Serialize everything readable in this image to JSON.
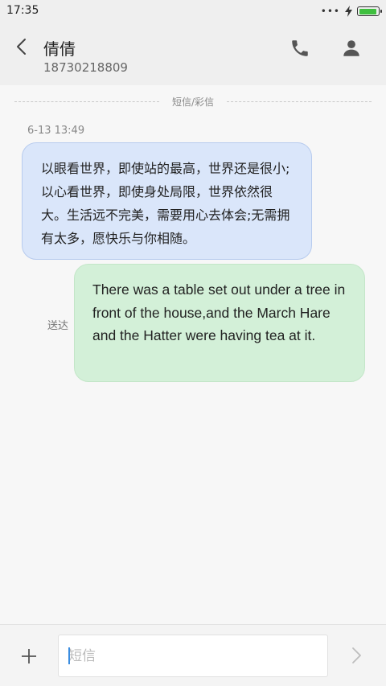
{
  "status_bar": {
    "time": "17:35",
    "signal_dots": "•••",
    "battery_fraction": 0.95,
    "icons": [
      "more-dots-icon",
      "charging-bolt-icon",
      "battery-icon"
    ]
  },
  "header": {
    "contact_name": "倩倩",
    "phone_number": "18730218809",
    "icons": [
      "back-arrow-icon",
      "phone-call-icon",
      "contact-profile-icon"
    ]
  },
  "conversation": {
    "channel_label": "短信/彩信",
    "timestamp": "6-13 13:49",
    "messages": [
      {
        "direction": "incoming",
        "text": "以眼看世界，即使站的最高，世界还是很小;以心看世界，即使身处局限，世界依然很大。生活远不完美，需要用心去体会;无需拥有太多，愿快乐与你相随。"
      },
      {
        "direction": "outgoing",
        "status": "送达",
        "text": "There was a table set out under a tree in front of the house,and the March Hare and the Hatter were having tea at it."
      }
    ]
  },
  "composer": {
    "placeholder": "短信",
    "value": "",
    "icons": [
      "plus-icon",
      "send-arrow-icon"
    ]
  },
  "colors": {
    "incoming_bubble": "#dae6fa",
    "outgoing_bubble": "#d3f0d8",
    "battery_fill": "#3fbf3f",
    "caret": "#3b8de0"
  }
}
